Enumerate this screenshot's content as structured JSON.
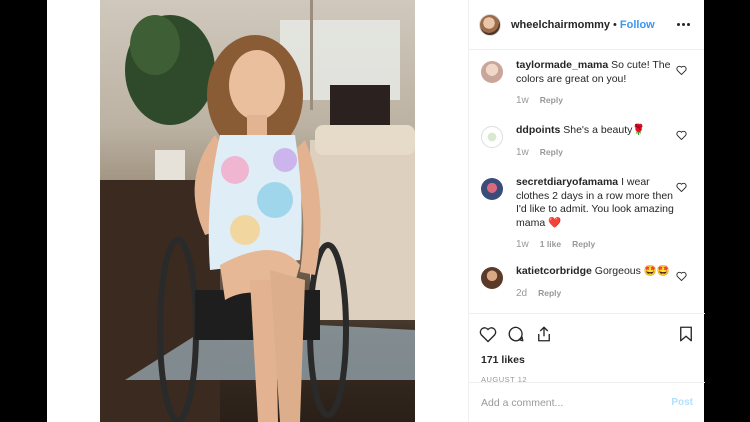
{
  "post": {
    "username": "wheelchairmommy",
    "separator": "•",
    "follow_label": "Follow"
  },
  "comments": [
    {
      "user": "taylormade_mama",
      "text": "So cute! The colors are great on you!",
      "time": "1w",
      "likes": "",
      "reply": "Reply"
    },
    {
      "user": "ddpoints",
      "text": "She's a beauty🌹",
      "time": "1w",
      "likes": "",
      "reply": "Reply"
    },
    {
      "user": "secretdiaryofamama",
      "text": "I wear clothes 2 days in a row more then I'd like to admit. You look amazing mama ❤️",
      "time": "1w",
      "likes": "1 like",
      "reply": "Reply"
    },
    {
      "user": "katietcorbridge",
      "text": "Gorgeous 🤩🤩",
      "time": "2d",
      "likes": "",
      "reply": "Reply"
    }
  ],
  "engagement": {
    "likes": "171 likes",
    "date": "AUGUST 12"
  },
  "composer": {
    "placeholder": "Add a comment...",
    "post_label": "Post"
  },
  "icons": {
    "like": "heart-icon",
    "comment": "comment-icon",
    "share": "share-icon",
    "save": "bookmark-icon",
    "more": "more-options-icon"
  },
  "colors": {
    "accent": "#3897f0",
    "post_disabled": "#b2dffc",
    "text": "#262626",
    "muted": "#999999"
  }
}
